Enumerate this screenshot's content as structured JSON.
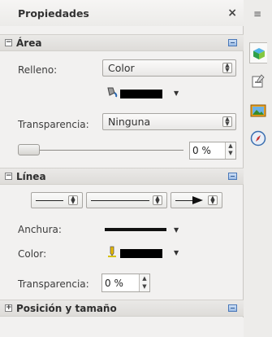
{
  "panel": {
    "title": "Propiedades",
    "close": "×"
  },
  "area": {
    "title": "Área",
    "fill_label": "Relleno:",
    "fill_value": "Color",
    "fill_color": "#000000",
    "transparency_label": "Transparencia:",
    "transparency_value": "Ninguna",
    "slider_value": "0 %"
  },
  "line": {
    "title": "Línea",
    "width_label": "Anchura:",
    "color_label": "Color:",
    "color_value": "#000000",
    "transparency_label": "Transparencia:",
    "transparency_value": "0 %"
  },
  "position": {
    "title": "Posición y tamaño"
  },
  "sidebar": {
    "menu_icon": "≡"
  }
}
